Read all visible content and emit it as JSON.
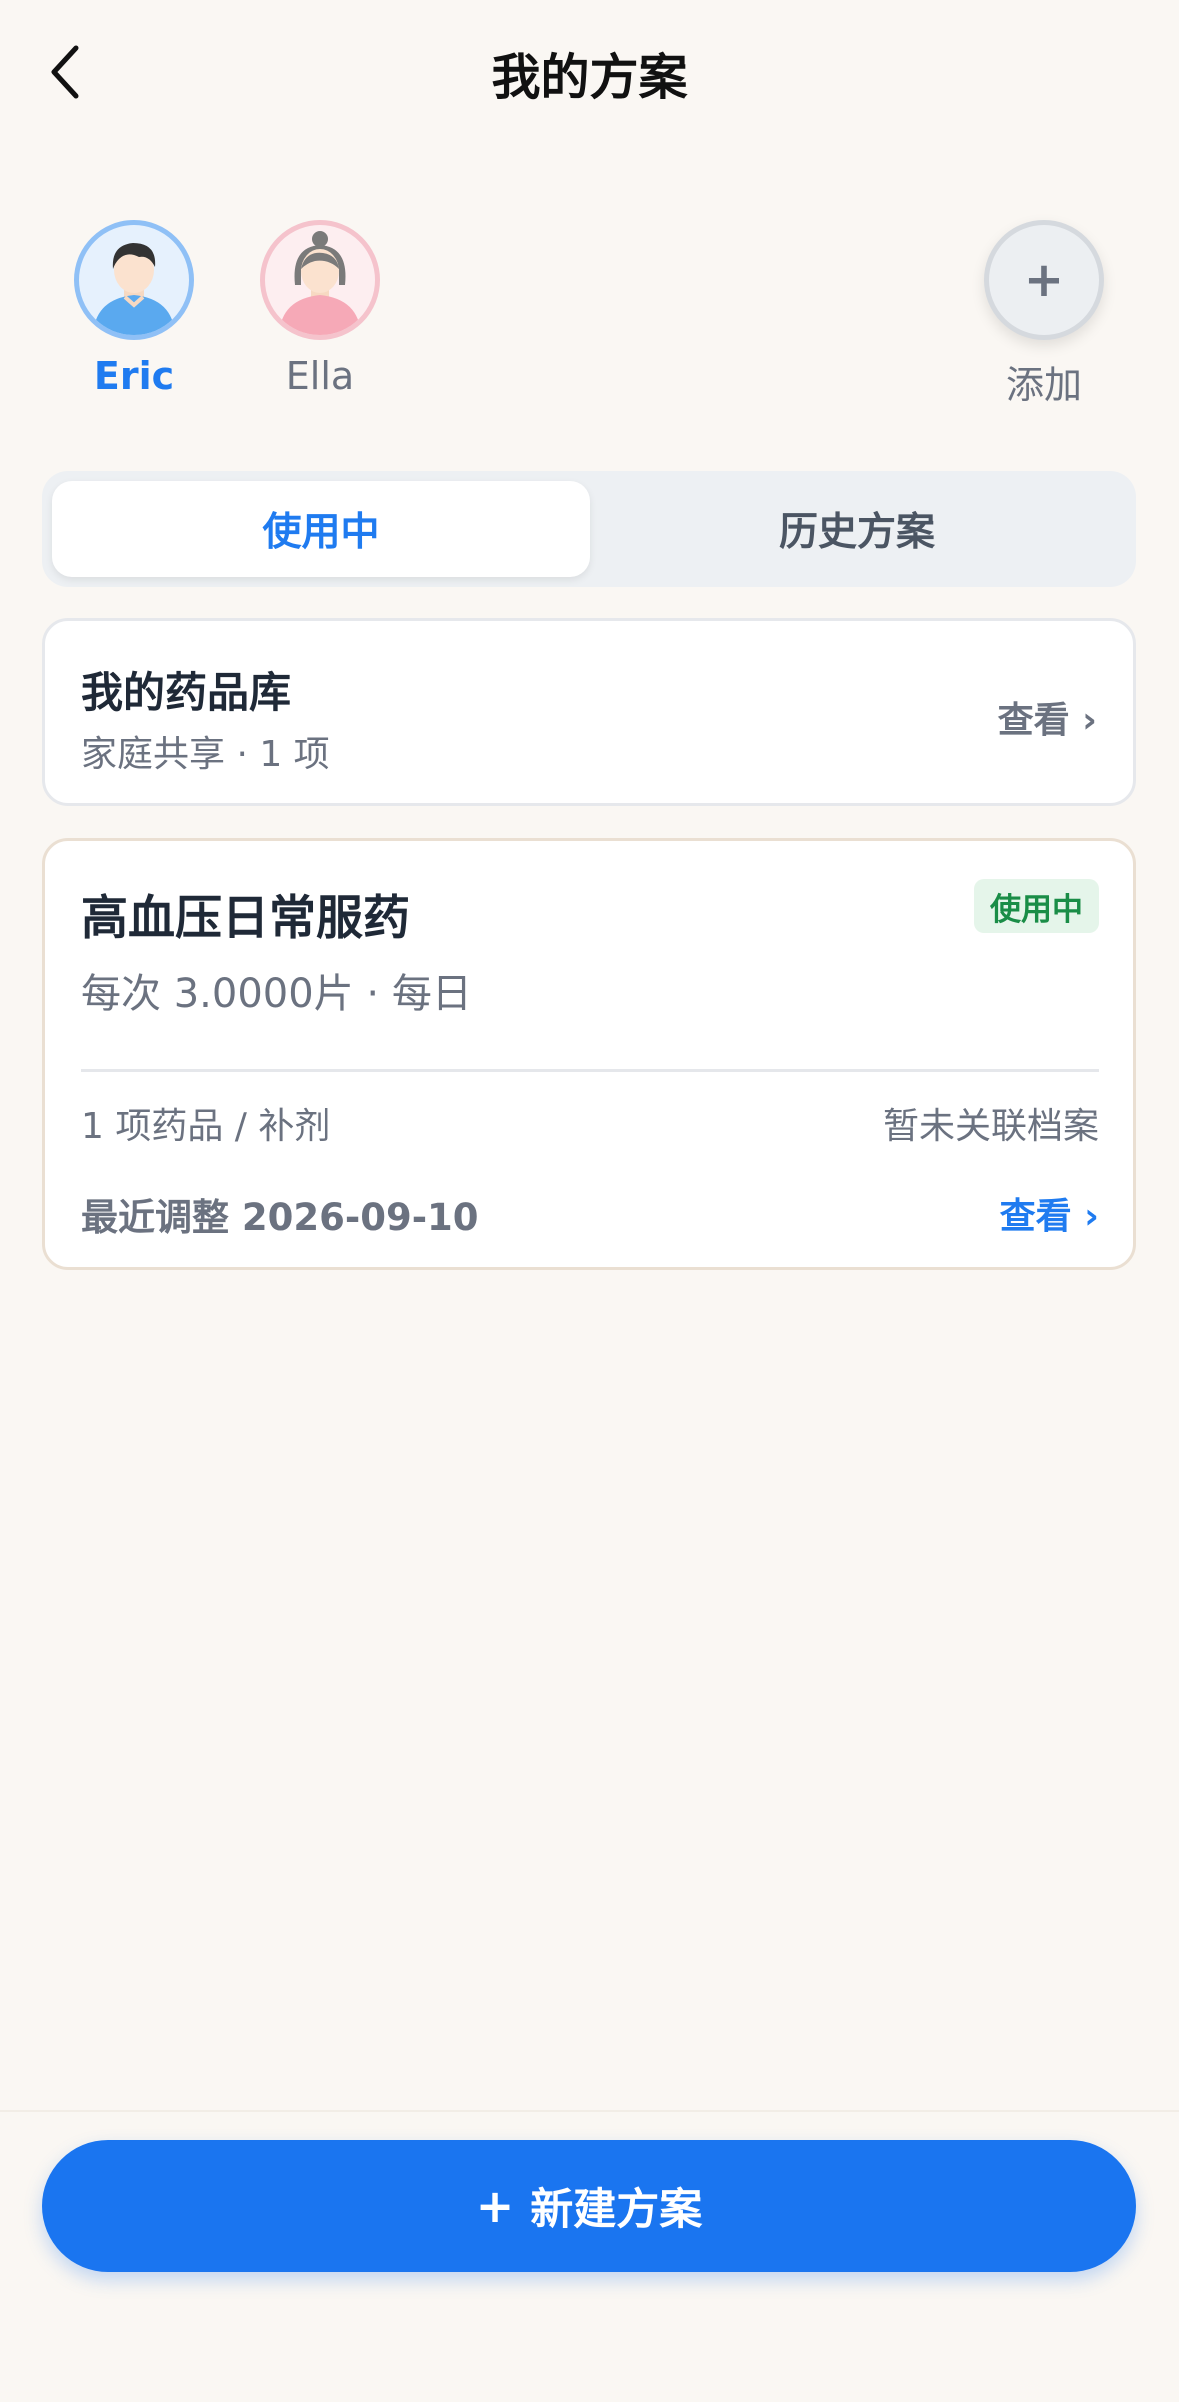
{
  "header": {
    "title": "我的方案"
  },
  "profiles": [
    {
      "name": "Eric",
      "active": true
    },
    {
      "name": "Ella",
      "active": false
    }
  ],
  "add_profile": {
    "icon": "plus-icon",
    "label": "添加"
  },
  "tabs": [
    {
      "label": "使用中",
      "active": true
    },
    {
      "label": "历史方案",
      "active": false
    }
  ],
  "medicine_library": {
    "title": "我的药品库",
    "subtitle": "家庭共享 · 1 项",
    "link": "查看 ›"
  },
  "plan": {
    "title": "高血压日常服药",
    "status": "使用中",
    "dose": "每次 3.0000片 · 每日",
    "count": "1 项药品 / 补剂",
    "link_status": "暂未关联档案",
    "adjusted": "最近调整 2026-09-10",
    "link": "查看 ›"
  },
  "footer": {
    "new_plan_icon": "+",
    "new_plan_label": "新建方案"
  },
  "colors": {
    "accent": "#1f7bf0",
    "button": "#1a75f0",
    "status_green": "#1a8d47",
    "background": "#faf7f3"
  }
}
